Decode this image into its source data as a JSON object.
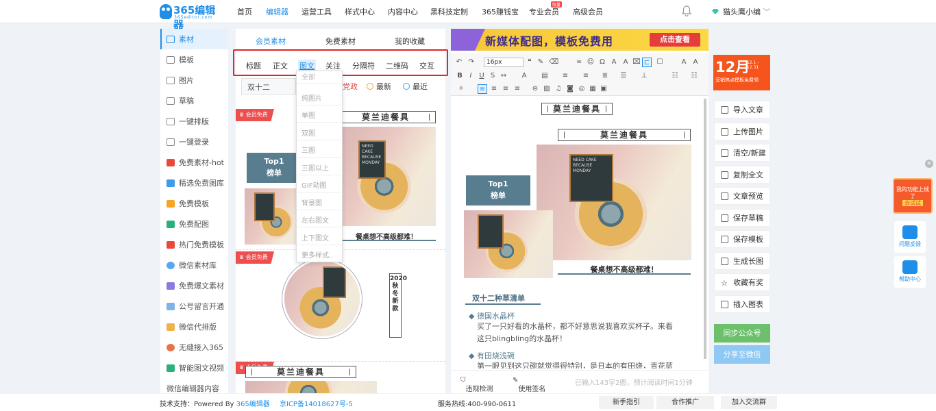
{
  "nav": {
    "logo_name": "365编辑器",
    "logo_sub": "365editor.com",
    "items": [
      "首页",
      "编辑器",
      "运营工具",
      "样式中心",
      "内容中心",
      "黑科技定制",
      "365赚钱宝",
      "专业会员",
      "高级会员"
    ],
    "pro_badge": "限量",
    "user": "猫头鹰小编"
  },
  "sidebar": {
    "items": [
      "素材",
      "模板",
      "图片",
      "草稿",
      "一键排版",
      "一键登录",
      "免费素材-hot",
      "精选免费图库",
      "免费模板",
      "免费配图",
      "热门免费模板",
      "微信素材库",
      "免费爆文素材",
      "公号留言开通",
      "微信代排版",
      "无缝接入365",
      "智能图文视频",
      "微信编辑器内容"
    ]
  },
  "material_tabs": [
    "会员素材",
    "免费素材",
    "我的收藏"
  ],
  "category_tabs": [
    "标题",
    "正文",
    "图文",
    "关注",
    "分隔符",
    "二维码",
    "交互"
  ],
  "search": {
    "value": "双十二"
  },
  "filters": [
    "免费",
    "党政",
    "最新",
    "最近"
  ],
  "dropdown": [
    "全部",
    "纯图片",
    "单图",
    "双图",
    "三图",
    "三图以上",
    "GIF动图",
    "背景图",
    "左右图文",
    "上下图文",
    "更多样式.."
  ],
  "cards": {
    "vip": "会员免费",
    "title": "莫兰迪餐具",
    "top1": "Top1",
    "top1_sub": "榜单",
    "caption": "餐桌想不高级都难！",
    "vertical": "2020秋冬新款",
    "board": "NEED CAKE BECAUSE MONDAY"
  },
  "banner": {
    "text": "新媒体配图，模板免费用",
    "button": "点击查看"
  },
  "toolbar": {
    "fontsize": "16px"
  },
  "editor": {
    "title1": "莫兰迪餐具",
    "title2": "莫兰迪餐具",
    "top1": "Top1",
    "top1_sub": "榜单",
    "caption": "餐桌想不高级都难！",
    "section": "双十二种草清单",
    "bullet1": "德国水晶杯",
    "para1a": "买了一只好看的水晶杯，都不好意思说我喜欢买杯子。来看",
    "para1b": "这只blingbling的水晶杯！",
    "bullet2": "有田烧浅碗",
    "para2a": "第一眼见到这只碗就觉得很特别，是日本的有田烧，青花蓝"
  },
  "status": {
    "check": "违规检测",
    "sign": "使用签名",
    "count": "已输入143字2图，预计阅读时间1分钟"
  },
  "promo": {
    "big": "12月",
    "small": "12.1 - 12.31",
    "bottom": "营销热点模板免费领"
  },
  "actions": [
    "导入文章",
    "上传图片",
    "清空/新建",
    "复制全文",
    "文章预览",
    "保存草稿",
    "保存模板",
    "生成长图",
    "收藏有奖",
    "插入图表"
  ],
  "sync_button": "同步公众号",
  "share_button": "分享至微信",
  "float": {
    "feedback": "问题反馈",
    "help": "帮助中心",
    "ad": "我的功能上线了",
    "ad_btn": "去试试"
  },
  "footer": {
    "support": "技术支持：Powered By",
    "brand": "365编辑器",
    "icp": "京ICP备14018627号-5",
    "hotline": "服务热线:400-990-0611",
    "btn1": "新手指引",
    "btn2": "合作推广",
    "btn3": "加入交流群"
  },
  "colors": {
    "accent": "#1e8ee8",
    "highlight_border": "#e02525",
    "vip": "#ef4e4e",
    "green": "#6cc06c",
    "slate": "#587d8f"
  }
}
